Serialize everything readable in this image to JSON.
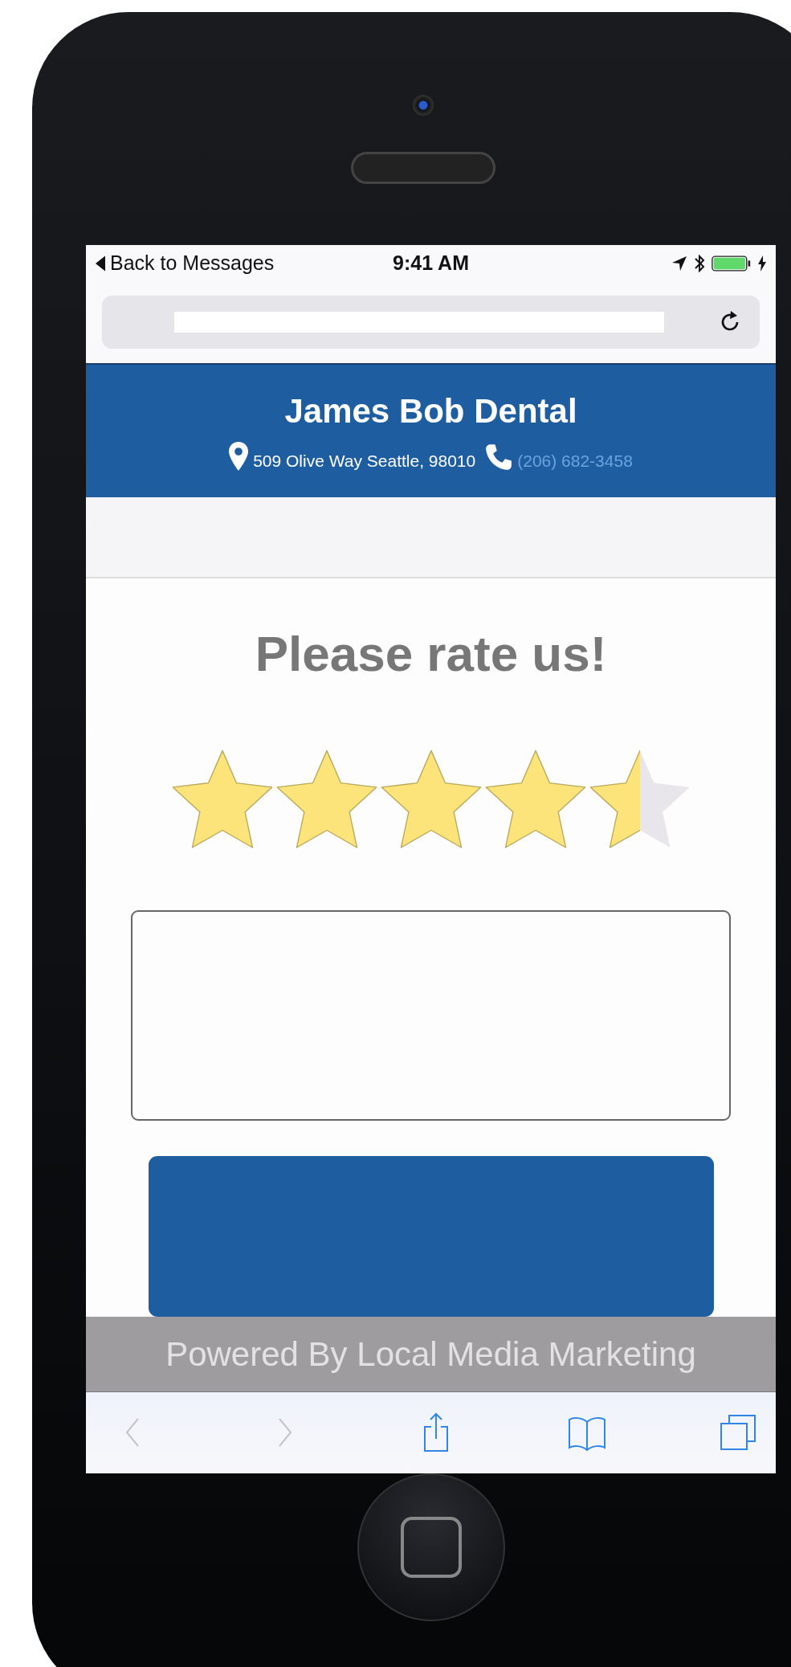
{
  "status_bar": {
    "back_label": "Back to Messages",
    "time": "9:41 AM"
  },
  "header": {
    "title": "James Bob Dental",
    "address": "509 Olive Way Seattle, 98010",
    "phone": "(206) 682-3458"
  },
  "rating": {
    "heading": "Please rate us!",
    "stars": 4.5
  },
  "toolbar": [
    {
      "kind": "back",
      "disabled": true
    },
    {
      "kind": "forward",
      "disabled": true
    },
    {
      "kind": "share",
      "disabled": false
    },
    {
      "kind": "bookmarks",
      "disabled": false
    },
    {
      "kind": "tabs",
      "disabled": false
    }
  ],
  "footer": {
    "text": "Powered By Local Media Marketing"
  }
}
